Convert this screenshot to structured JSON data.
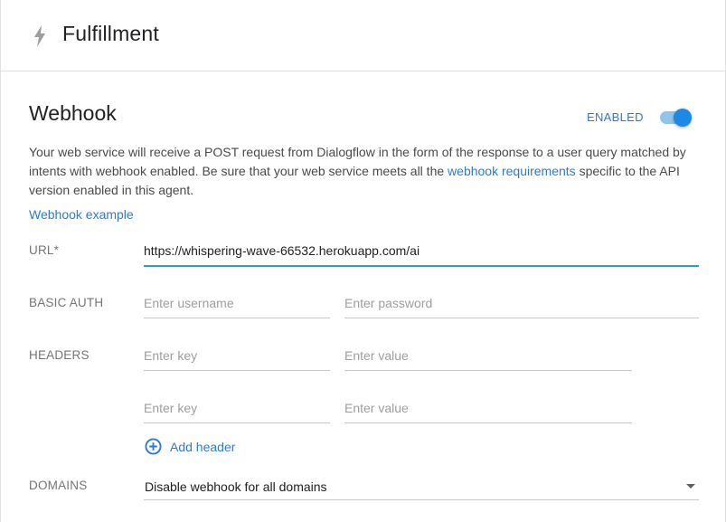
{
  "header": {
    "title": "Fulfillment",
    "icon": "bolt-icon"
  },
  "webhook": {
    "title": "Webhook",
    "status_label": "ENABLED",
    "enabled": true,
    "description_part1": "Your web service will receive a POST request from Dialogflow in the form of the response to a user query matched by intents with webhook enabled. Be sure that your web service meets all the ",
    "requirements_link": "webhook requirements",
    "description_part2": " specific to the API version enabled in this agent.",
    "example_link": "Webhook example"
  },
  "url": {
    "label": "URL*",
    "value": "https://whispering-wave-66532.herokuapp.com/ai"
  },
  "basic_auth": {
    "label": "BASIC AUTH",
    "username_placeholder": "Enter username",
    "password_placeholder": "Enter password"
  },
  "headers": {
    "label": "HEADERS",
    "rows": [
      {
        "key_placeholder": "Enter key",
        "value_placeholder": "Enter value"
      },
      {
        "key_placeholder": "Enter key",
        "value_placeholder": "Enter value"
      }
    ],
    "add_label": "Add header",
    "add_icon": "plus-circle-icon"
  },
  "domains": {
    "label": "DOMAINS",
    "selected": "Disable webhook for all domains"
  },
  "colors": {
    "accent": "#2b7bd6",
    "toggle_on": "#1e88e5",
    "toggle_track": "#8ec5ef",
    "active_underline": "#2b9cd6"
  }
}
